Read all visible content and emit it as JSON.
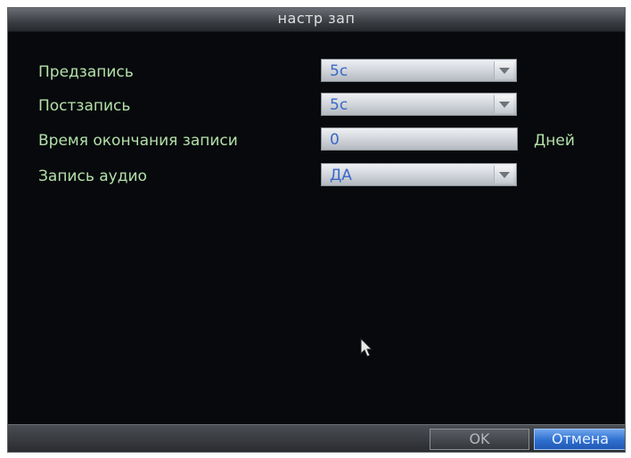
{
  "dialog": {
    "title": "настр зап"
  },
  "settings": [
    {
      "label": "Предзапись",
      "value": "5с",
      "control": "select"
    },
    {
      "label": "Постзапись",
      "value": "5с",
      "control": "select"
    },
    {
      "label": "Время окончания записи",
      "value": "0",
      "control": "text",
      "unit": "Дней"
    },
    {
      "label": "Запись аудио",
      "value": "ДА",
      "control": "select"
    }
  ],
  "buttons": {
    "ok": "OK",
    "cancel": "Отмена"
  },
  "colors": {
    "background": "#07090c",
    "label": "#b3e0a9",
    "field_value": "#3a68c8",
    "cancel_accent": "#2f6fcf"
  },
  "icons": {
    "dropdown": "chevron-down-icon",
    "pointer": "mouse-pointer-icon"
  }
}
